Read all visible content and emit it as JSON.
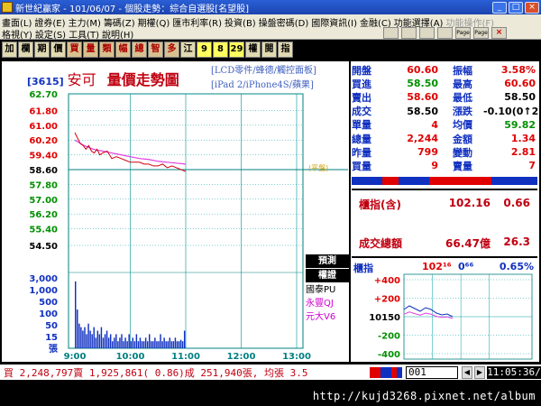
{
  "window": {
    "title": "新世紀贏家 - 101/06/07 - 個股走勢：綜合自選股[名望股]"
  },
  "menu": {
    "row1": [
      "畫面(L)",
      "證券(E)",
      "主力(M)",
      "籌碼(Z)",
      "期權(Q)",
      "匯市利率(R)",
      "投資(B)",
      "操盤密碼(D)",
      "國際資訊(I)",
      "金融(C)",
      "功能選擇(A)",
      "功能操作(F)"
    ],
    "row2": [
      "格視(Y)",
      "設定(S)",
      "工具(T)",
      "說明(H)"
    ],
    "tools": [
      "",
      "",
      "",
      "",
      "Page",
      "Page",
      "×"
    ]
  },
  "toolbar": {
    "buttons": [
      "加",
      "欄",
      "期",
      "價",
      "買",
      "量",
      "類",
      "幅",
      "總",
      "智",
      "多",
      "江",
      "9",
      "8",
      "29",
      "權",
      "閱",
      "指"
    ]
  },
  "stock": {
    "code": "[3615]",
    "name": "安可",
    "chart_title": "量價走勢圖",
    "tags": [
      "[LCD零件/蜂德/觸控面板]",
      "[iPad 2/iPhone4S/蘋果]"
    ]
  },
  "legend": [
    "預測",
    "權證",
    "國泰PU",
    "永豐QJ",
    "元大V6"
  ],
  "flat_tag": "(平盤)",
  "quote": {
    "rows": [
      {
        "k1": "開盤",
        "v1": "60.60",
        "c1": "red",
        "k2": "振幅",
        "v2": "3.58%",
        "c2": "red"
      },
      {
        "k1": "買進",
        "v1": "58.50",
        "c1": "green",
        "k2": "最高",
        "v2": "60.60",
        "c2": "red"
      },
      {
        "k1": "賣出",
        "v1": "58.60",
        "c1": "red",
        "k2": "最低",
        "v2": "58.50",
        "c2": "blk"
      },
      {
        "k1": "成交",
        "v1": "58.50",
        "c1": "blk",
        "k2": "漲跌",
        "v2": "-0.10(0↑2)",
        "c2": "blk"
      },
      {
        "k1": "單量",
        "v1": "4",
        "c1": "red",
        "k2": "均價",
        "v2": "59.82",
        "c2": "green"
      },
      {
        "k1": "總量",
        "v1": "2,244",
        "c1": "red",
        "k2": "金額",
        "v2": "1.34",
        "c2": "red"
      },
      {
        "k1": "昨量",
        "v1": "799",
        "c1": "red",
        "k2": "變動",
        "v2": "2.81",
        "c2": "red"
      },
      {
        "k1": "買量",
        "v1": "9",
        "c1": "red",
        "k2": "賣量",
        "v2": "7",
        "c2": "red"
      }
    ],
    "bar_colors": [
      "#1030c0",
      "#1030c0",
      "#e00000",
      "#1030c0",
      "#1030c0",
      "#e00000",
      "#e00000",
      "#e00000",
      "#e00000",
      "#1030c0",
      "#1030c0",
      "#1030c0"
    ]
  },
  "index": {
    "row1": {
      "k": "櫃指(含)",
      "v1": "102.16",
      "v2": "0.66"
    },
    "row2": {
      "k": "成交總額",
      "v1": "66.47億",
      "v2": "26.3"
    }
  },
  "mini_chart": {
    "head": {
      "k": "櫃指",
      "v1": "102¹⁶",
      "v2": "0⁶⁶",
      "v3": "0.65%"
    },
    "y_labels": [
      "+400",
      "+200",
      "10150",
      "-200",
      "-400"
    ]
  },
  "status": {
    "text": "買 2,248,797賣 1,925,861( 0.86)成 251,940張, 均張 3.5",
    "colors": [
      "#e00000",
      "#e00000",
      "#1030c0",
      "#1030c0",
      "#e00000",
      "#1030c0"
    ],
    "code": "001",
    "arrows": [
      "◀",
      "▶"
    ],
    "time": "11:05:36/"
  },
  "watermark": "http://kujd3268.pixnet.net/album",
  "chart_data": {
    "type": "line",
    "x_ticks": [
      "9:00",
      "10:00",
      "11:00",
      "12:00",
      "13:00"
    ],
    "price_ticks": [
      "62.70",
      "61.80",
      "61.00",
      "60.20",
      "59.40",
      "58.60",
      "57.80",
      "57.00",
      "56.20",
      "55.40",
      "54.50"
    ],
    "price_ylim": [
      54.5,
      62.7
    ],
    "reference_price": 58.6,
    "volume_ticks": [
      "3,000",
      "1,000",
      "500",
      "100",
      "50",
      "15",
      "張"
    ],
    "price_series": {
      "name": "",
      "time_min": [
        0,
        3,
        6,
        9,
        12,
        15,
        18,
        21,
        24,
        27,
        30,
        35,
        40,
        45,
        50,
        55,
        60,
        65,
        70,
        75,
        80,
        85,
        90,
        95,
        100,
        105,
        110,
        115,
        120
      ],
      "values": [
        60.6,
        60.3,
        60.0,
        59.9,
        59.7,
        59.9,
        59.6,
        59.5,
        59.7,
        59.4,
        59.5,
        59.6,
        59.2,
        59.3,
        59.2,
        59.1,
        59.0,
        59.0,
        59.0,
        58.9,
        58.9,
        58.8,
        58.8,
        58.9,
        58.7,
        58.8,
        58.7,
        58.6,
        58.5
      ]
    },
    "avg_series": {
      "name": "",
      "time_min": [
        0,
        10,
        20,
        30,
        40,
        50,
        60,
        70,
        80,
        90,
        100,
        110,
        120
      ],
      "values": [
        60.2,
        59.9,
        59.7,
        59.6,
        59.5,
        59.4,
        59.3,
        59.2,
        59.15,
        59.05,
        59.0,
        58.95,
        58.9
      ]
    },
    "volume_level": [
      0.95,
      0.55,
      0.35,
      0.3,
      0.25,
      0.3,
      0.2,
      0.35,
      0.25,
      0.2,
      0.3,
      0.15,
      0.25,
      0.2,
      0.3,
      0.15,
      0.2,
      0.25,
      0.15,
      0.2,
      0.1,
      0.15,
      0.2,
      0.1,
      0.15,
      0.2,
      0.1,
      0.15,
      0.1,
      0.2,
      0.1,
      0.15,
      0.1,
      0.2,
      0.1,
      0.15,
      0.1,
      0.1,
      0.15,
      0.1,
      0.2,
      0.1,
      0.1,
      0.15,
      0.1,
      0.1,
      0.2,
      0.1,
      0.15,
      0.1,
      0.1,
      0.15,
      0.1,
      0.1,
      0.15,
      0.1,
      0.1,
      0.12,
      0.1,
      0.25
    ]
  }
}
